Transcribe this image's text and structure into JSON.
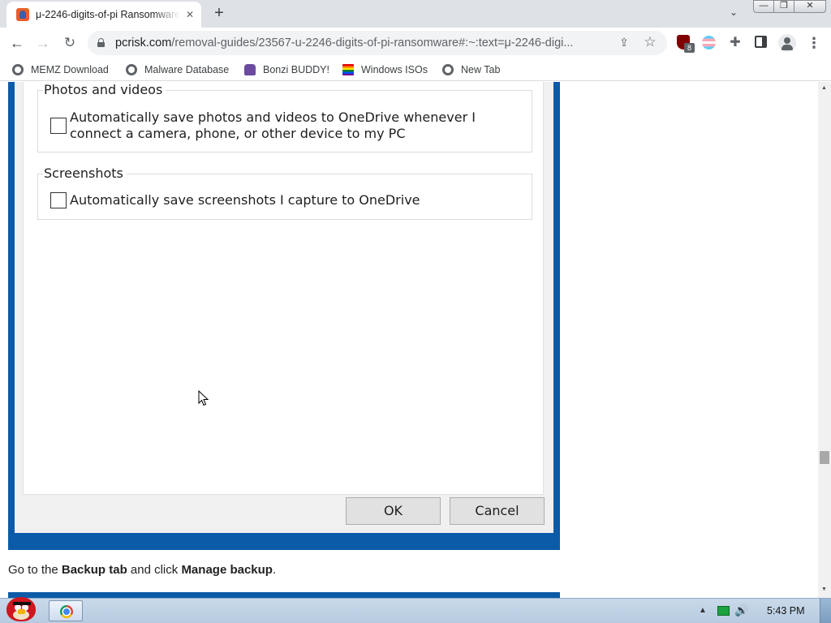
{
  "browser": {
    "tab": {
      "title": "μ-2246-digits-of-pi Ransomware",
      "close_glyph": "✕",
      "favicon": "pcrisk-favicon"
    },
    "new_tab_glyph": "+",
    "tab_search_glyph": "⌄",
    "window_controls": {
      "minimize": "—",
      "maximize": "❐",
      "close": "✕"
    },
    "nav": {
      "back": "←",
      "forward": "→",
      "reload": "↻"
    },
    "address": {
      "host": "pcrisk.com",
      "path": "/removal-guides/23567-u-2246-digits-of-pi-ransomware#:~:text=μ-2246-digi..."
    },
    "toolbar_icons": {
      "share": "⇪",
      "bookmark_star": "☆",
      "ublock_badge": "8",
      "extensions": "✚",
      "menu": "⋮"
    },
    "bookmarks": [
      {
        "label": "MEMZ Download",
        "icon": "globe-icon"
      },
      {
        "label": "Malware Database",
        "icon": "globe-icon"
      },
      {
        "label": "Bonzi BUDDY!",
        "icon": "bonzi-icon"
      },
      {
        "label": "Windows ISOs",
        "icon": "rainbow-flag-icon"
      },
      {
        "label": "New Tab",
        "icon": "globe-icon"
      }
    ]
  },
  "dialog": {
    "photos_group": {
      "title": "Photos and videos",
      "checkbox_label": "Automatically save photos and videos to OneDrive whenever I connect a camera, phone, or other device to my PC",
      "checked": false
    },
    "screenshots_group": {
      "title": "Screenshots",
      "checkbox_label": "Automatically save screenshots I capture to OneDrive",
      "checked": false
    },
    "ok_label": "OK",
    "cancel_label": "Cancel"
  },
  "article": {
    "text_1": "Go to the ",
    "bold_1": "Backup tab",
    "text_2": " and click ",
    "bold_2": "Manage backup",
    "text_3": "."
  },
  "scrollbar": {
    "up": "▲",
    "down": "▼"
  },
  "taskbar": {
    "tray_arrow": "▲",
    "volume_glyph": "🔊",
    "clock": "5:43 PM"
  },
  "colors": {
    "dialog_frame": "#0b5ba8",
    "tab_strip": "#dee1e6",
    "taskbar": "#c9d9ea"
  }
}
